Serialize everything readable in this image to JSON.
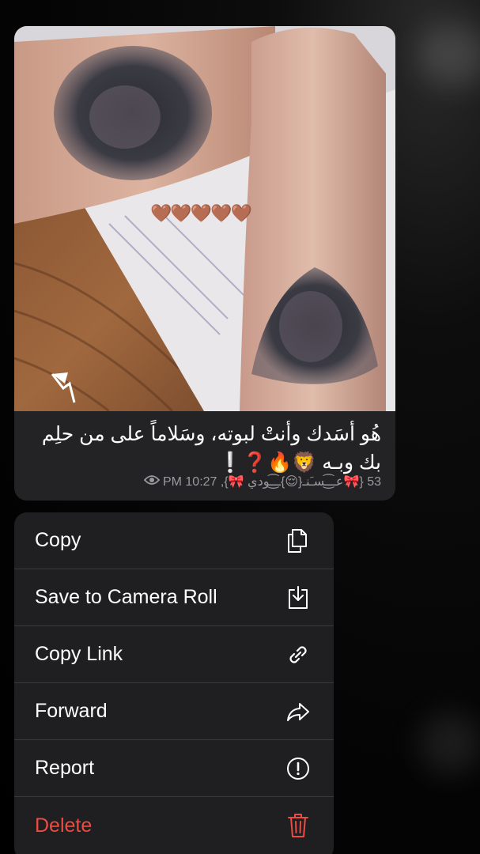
{
  "message": {
    "overlay_emoji": "🤎🤎🤎🤎🤎",
    "caption": "هُو أسَدك وأنتْ لبوته، وسَلاماً على من حلِم بك وبـه 🦁🔥❓❕",
    "views": "53",
    "author": "{🎀عــ͜͡ـسـَنـ{😌}ــ͜͡ـودي 🎀},",
    "time": "PM 10:27"
  },
  "menu": {
    "items": [
      {
        "label": "Copy",
        "icon": "copy-icon"
      },
      {
        "label": "Save to Camera Roll",
        "icon": "save-download-icon"
      },
      {
        "label": "Copy Link",
        "icon": "link-icon"
      },
      {
        "label": "Forward",
        "icon": "forward-arrow-icon"
      },
      {
        "label": "Report",
        "icon": "exclamation-circle-icon"
      },
      {
        "label": "Delete",
        "icon": "trash-icon"
      }
    ]
  },
  "colors": {
    "danger": "#eb4c43",
    "menu_bg": "#1f1f21",
    "bubble_bg": "#232326"
  }
}
